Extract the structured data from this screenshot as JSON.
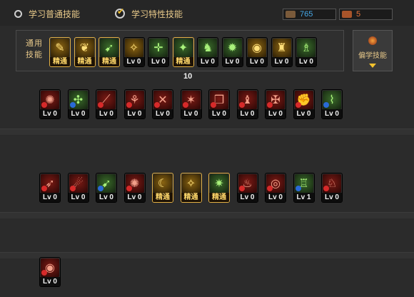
{
  "tabs": [
    {
      "label": "学习普通技能"
    },
    {
      "label": "学习特性技能"
    }
  ],
  "currency": {
    "points_a": "765",
    "points_b": "5"
  },
  "common_panel": {
    "label_line1": "通用",
    "label_line2": "技能",
    "count": "10",
    "skills": [
      {
        "icon": "scroll-icon",
        "glyph": "✎",
        "label": "精通",
        "style": "gold"
      },
      {
        "icon": "wing-icon",
        "glyph": "❦",
        "label": "精通",
        "style": "gold"
      },
      {
        "icon": "runner-icon",
        "glyph": "➹",
        "label": "精通",
        "style": "green"
      },
      {
        "icon": "eagle-icon",
        "glyph": "✧",
        "label": "Lv 0",
        "style": "gold"
      },
      {
        "icon": "crosshair-icon",
        "glyph": "✛",
        "label": "Lv 0",
        "style": "green"
      },
      {
        "icon": "target-icon",
        "glyph": "✦",
        "label": "精通",
        "style": "green"
      },
      {
        "icon": "rider-icon",
        "glyph": "♞",
        "label": "Lv 0",
        "style": "green"
      },
      {
        "icon": "kick-icon",
        "glyph": "✹",
        "label": "Lv 0",
        "style": "green"
      },
      {
        "icon": "eye-icon",
        "glyph": "◉",
        "label": "Lv 0",
        "style": "gold"
      },
      {
        "icon": "warrior-icon",
        "glyph": "♜",
        "label": "Lv 0",
        "style": "gold"
      },
      {
        "icon": "figure-icon",
        "glyph": "♗",
        "label": "Lv 0",
        "style": "green"
      }
    ]
  },
  "side_button": {
    "label": "偏学技能"
  },
  "rows": [
    [
      {
        "icon": "swirl-icon",
        "glyph": "✺",
        "label": "Lv 0",
        "style": "red"
      },
      {
        "icon": "spark-icon",
        "glyph": "✣",
        "label": "Lv 0",
        "style": "green"
      },
      {
        "icon": "slash-icon",
        "glyph": "⟋",
        "label": "Lv 0",
        "style": "red"
      },
      {
        "icon": "sigil-icon",
        "glyph": "⚘",
        "label": "Lv 0",
        "style": "red"
      },
      {
        "icon": "cross-blades-icon",
        "glyph": "✕",
        "label": "Lv 0",
        "style": "red"
      },
      {
        "icon": "claw-icon",
        "glyph": "✶",
        "label": "Lv 0",
        "style": "red"
      },
      {
        "icon": "cube-icon",
        "glyph": "❒",
        "label": "Lv 0",
        "style": "red"
      },
      {
        "icon": "mage-icon",
        "glyph": "♝",
        "label": "Lv 0",
        "style": "red"
      },
      {
        "icon": "scroll-fire-icon",
        "glyph": "✠",
        "label": "Lv 0",
        "style": "red"
      },
      {
        "icon": "fist-icon",
        "glyph": "✊",
        "label": "Lv 0",
        "style": "red"
      },
      {
        "icon": "whip-icon",
        "glyph": "⌇",
        "label": "Lv 0",
        "style": "green"
      }
    ],
    [
      {
        "icon": "strike-icon",
        "glyph": "➶",
        "label": "Lv 0",
        "style": "red"
      },
      {
        "icon": "comet-icon",
        "glyph": "☄",
        "label": "Lv 0",
        "style": "red"
      },
      {
        "icon": "dash-icon",
        "glyph": "➹",
        "label": "Lv 0",
        "style": "green"
      },
      {
        "icon": "fireball-icon",
        "glyph": "✺",
        "label": "Lv 0",
        "style": "red"
      },
      {
        "icon": "moon-icon",
        "glyph": "☾",
        "label": "精通",
        "style": "gold"
      },
      {
        "icon": "horn-icon",
        "glyph": "✧",
        "label": "精通",
        "style": "gold"
      },
      {
        "icon": "burst-icon",
        "glyph": "✷",
        "label": "精通",
        "style": "green"
      },
      {
        "icon": "flame-icon",
        "glyph": "♨",
        "label": "Lv 0",
        "style": "red"
      },
      {
        "icon": "vortex-icon",
        "glyph": "◎",
        "label": "Lv 0",
        "style": "red"
      },
      {
        "icon": "pillars-icon",
        "glyph": "♖",
        "label": "Lv 1",
        "style": "green"
      },
      {
        "icon": "beast-icon",
        "glyph": "♘",
        "label": "Lv 0",
        "style": "red"
      }
    ],
    [
      {
        "icon": "eye-spiral-icon",
        "glyph": "◉",
        "label": "Lv 0",
        "style": "red"
      }
    ]
  ]
}
